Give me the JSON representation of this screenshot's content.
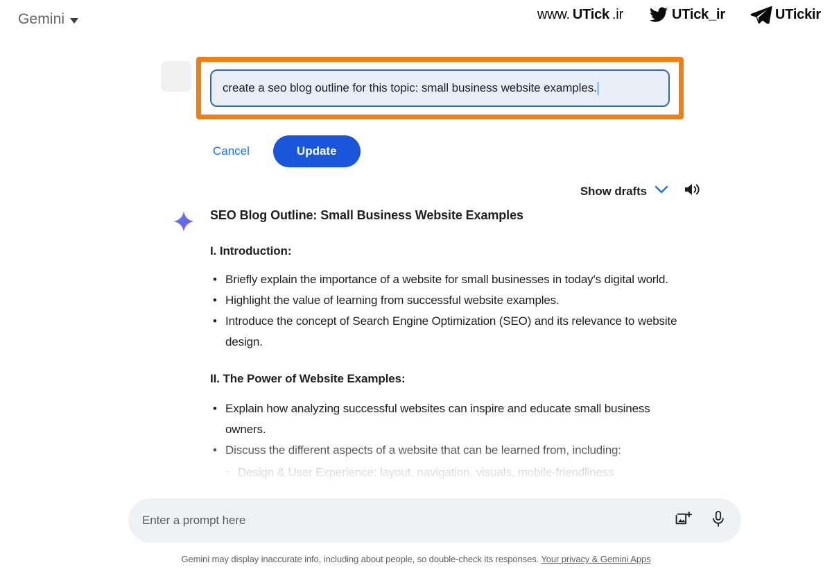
{
  "header": {
    "model_name": "Gemini",
    "caret_icon": "chevron-down-icon",
    "watermark": {
      "website_prefix": "www.",
      "website_brand": "UTick",
      "website_suffix": ".ir",
      "twitter_handle": "UTick_ir",
      "telegram_handle": "UTickir"
    }
  },
  "edit_prompt": {
    "value": "create a seo blog outline for this topic: small business website examples.",
    "cancel_label": "Cancel",
    "update_label": "Update",
    "highlight_color": "#ef7f10",
    "input_border_color": "#2c6ab5",
    "input_background": "#e9eef6",
    "update_button_color": "#1a56db",
    "cancel_link_color": "#1a73e8"
  },
  "drafts": {
    "label": "Show drafts",
    "chevron_icon": "chevron-down-icon",
    "chevron_color": "#1a73e8",
    "speaker_icon": "speaker-icon"
  },
  "response": {
    "sparkle_icon": "sparkle-icon",
    "sparkle_colors": [
      "#4285f4",
      "#7b5ce0"
    ],
    "title": "SEO Blog Outline: Small Business Website Examples",
    "sections": [
      {
        "heading": "I. Introduction:",
        "bullets": [
          "Briefly explain the importance of a website for small businesses in today's digital world.",
          "Highlight the value of learning from successful website examples.",
          "Introduce the concept of Search Engine Optimization (SEO) and its relevance to website design."
        ]
      },
      {
        "heading": "II. The Power of Website Examples:",
        "bullets": [
          "Explain how analyzing successful websites can inspire and educate small business owners.",
          "Discuss the different aspects of a website that can be learned from, including:"
        ],
        "nested": [
          "Design & User Experience: layout, navigation, visuals, mobile-friendliness"
        ]
      }
    ]
  },
  "prompt_bar": {
    "placeholder": "Enter a prompt here",
    "image_icon": "add-image-icon",
    "mic_icon": "microphone-icon"
  },
  "footer": {
    "disclaimer": "Gemini may display inaccurate info, including about people, so double-check its responses.",
    "link_label": "Your privacy & Gemini Apps"
  }
}
